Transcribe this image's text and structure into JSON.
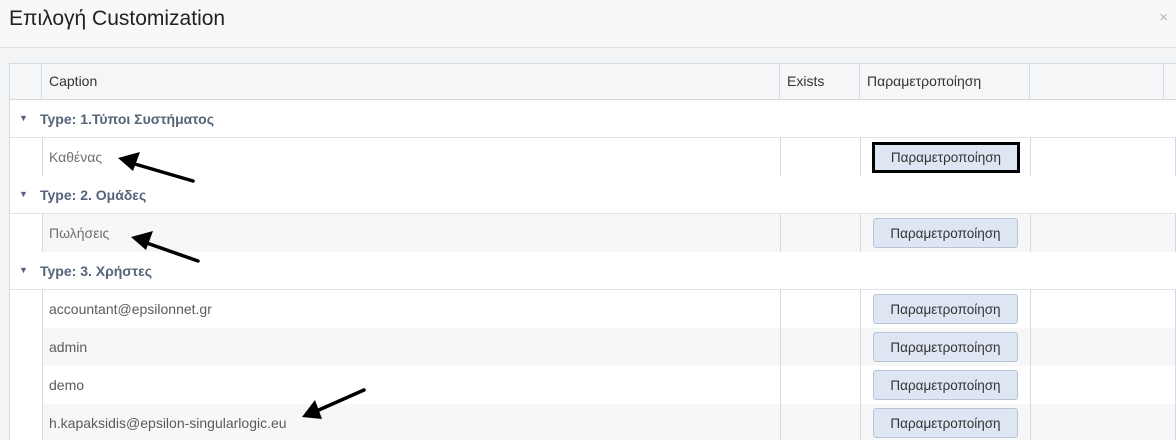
{
  "dialog": {
    "title": "Επιλογή Customization",
    "close_glyph": "×"
  },
  "grid": {
    "columns": {
      "caption": "Caption",
      "exists": "Exists",
      "param": "Παραμετροποίηση"
    },
    "groups": [
      {
        "label": "Type: 1.Τύποι Συστήματος",
        "toggle": "▼",
        "rows": [
          {
            "caption": "Καθένας",
            "button": "Παραμετροποίηση"
          }
        ]
      },
      {
        "label": "Type: 2. Ομάδες",
        "toggle": "▼",
        "rows": [
          {
            "caption": "Πωλήσεις",
            "button": "Παραμετροποίηση"
          }
        ]
      },
      {
        "label": "Type: 3. Χρήστες",
        "toggle": "▼",
        "rows": [
          {
            "caption": "accountant@epsilonnet.gr",
            "button": "Παραμετροποίηση"
          },
          {
            "caption": "admin",
            "button": "Παραμετροποίηση"
          },
          {
            "caption": "demo",
            "button": "Παραμετροποίηση"
          },
          {
            "caption": "h.kapaksidis@epsilon-singularlogic.eu",
            "button": "Παραμετροποίηση"
          }
        ]
      }
    ]
  },
  "colors": {
    "group_label": "#55647a",
    "button_bg": "#dde6f2",
    "annotation_arrow": "#000000"
  }
}
